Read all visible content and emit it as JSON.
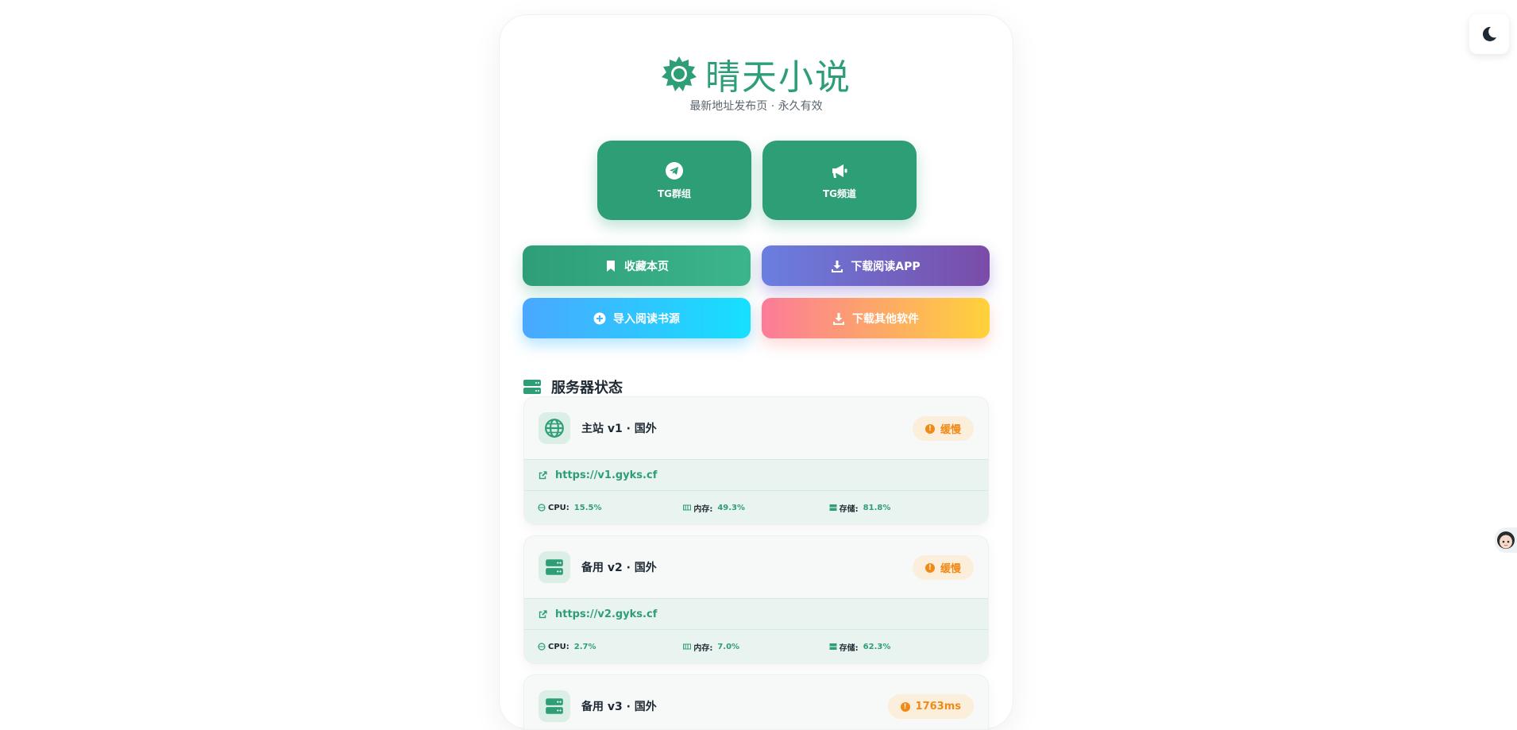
{
  "header": {
    "title": "晴天小说",
    "subtitle": "最新地址发布页 · 永久有效",
    "brand_color": "#2e9e77"
  },
  "tg_buttons": [
    {
      "label": "TG群组",
      "icon": "telegram-icon"
    },
    {
      "label": "TG频道",
      "icon": "megaphone-icon"
    }
  ],
  "actions": [
    {
      "label": "收藏本页",
      "icon": "bookmark-icon"
    },
    {
      "label": "下载阅读APP",
      "icon": "download-icon"
    },
    {
      "label": "导入阅读书源",
      "icon": "plus-circle-icon"
    },
    {
      "label": "下载其他软件",
      "icon": "download-icon"
    }
  ],
  "servers_section": {
    "title": "服务器状态",
    "icon": "server-icon"
  },
  "servers": [
    {
      "name": "主站 v1 · 国外",
      "icon": "globe-icon",
      "status": "缓慢",
      "url": "https://v1.gyks.cf",
      "cpu_label": "CPU:",
      "cpu": "15.5%",
      "mem_label": "内存:",
      "mem": "49.3%",
      "disk_label": "存储:",
      "disk": "81.8%"
    },
    {
      "name": "备用 v2 · 国外",
      "icon": "server-icon",
      "status": "缓慢",
      "url": "https://v2.gyks.cf",
      "cpu_label": "CPU:",
      "cpu": "2.7%",
      "mem_label": "内存:",
      "mem": "7.0%",
      "disk_label": "存储:",
      "disk": "62.3%"
    },
    {
      "name": "备用 v3 · 国外",
      "icon": "server-icon",
      "status": "1763ms"
    }
  ],
  "theme_toggle": {
    "icon": "moon-icon"
  },
  "status_color": "#f08a17"
}
